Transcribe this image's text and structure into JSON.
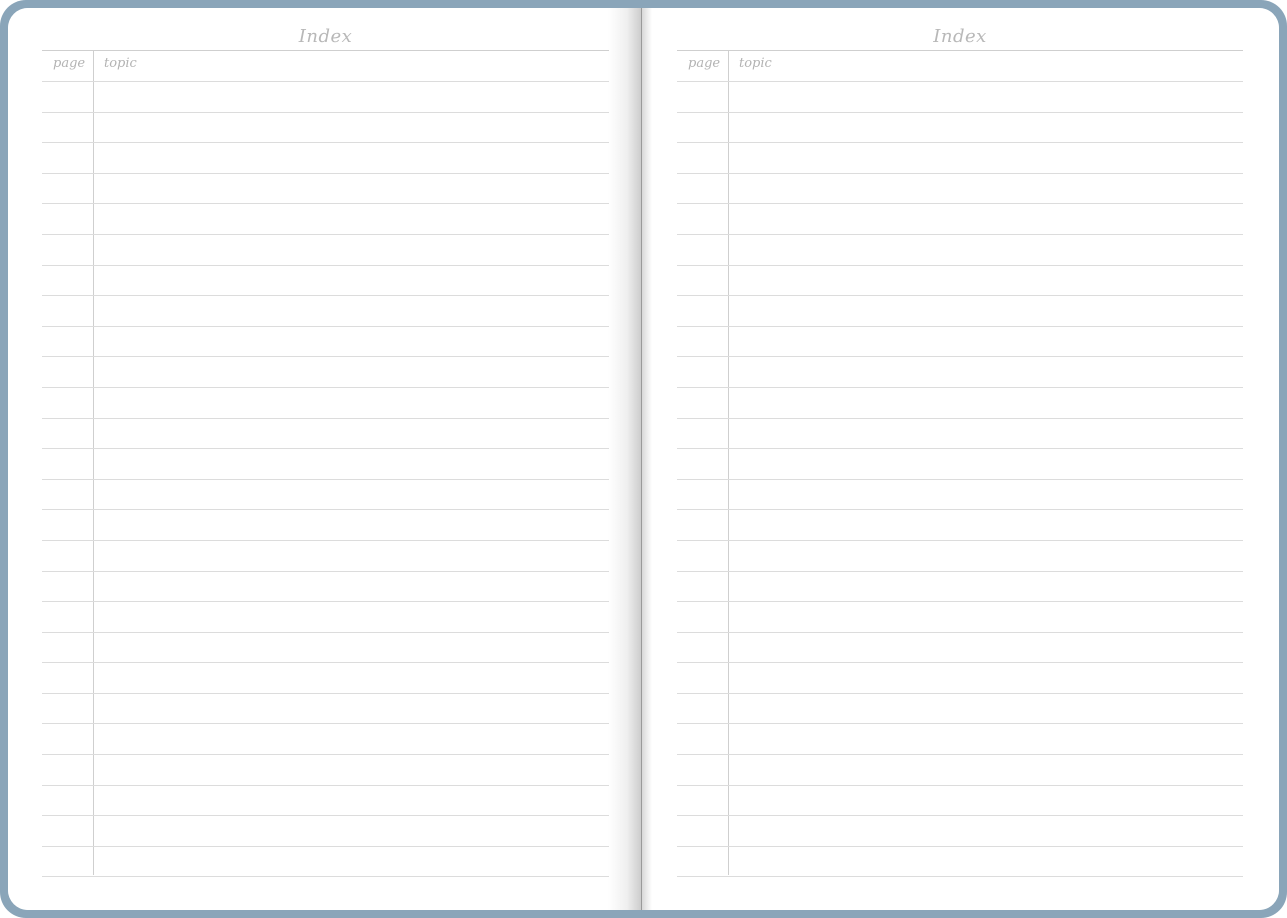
{
  "pages": [
    {
      "title": "Index",
      "headers": {
        "page": "page",
        "topic": "topic"
      },
      "row_count": 26
    },
    {
      "title": "Index",
      "headers": {
        "page": "page",
        "topic": "topic"
      },
      "row_count": 26
    }
  ],
  "colors": {
    "cover": "#8aa5b9",
    "paper": "#ffffff",
    "rule": "#dcdcdc",
    "text": "#b3b3b3"
  }
}
